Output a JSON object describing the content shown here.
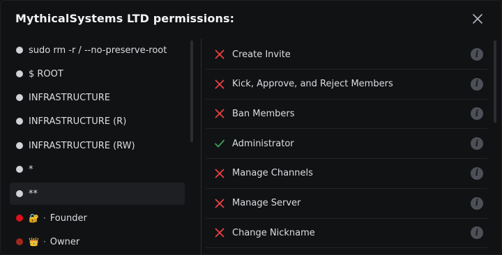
{
  "modal": {
    "title": "MythicalSystems LTD permissions:"
  },
  "roles": [
    {
      "name": "sudo rm -r / --no-preserve-root",
      "color": "#cfd3d8",
      "badge": "",
      "selected": false
    },
    {
      "name": "$ ROOT",
      "color": "#cfd3d8",
      "badge": "",
      "selected": false
    },
    {
      "name": "INFRASTRUCTURE",
      "color": "#cfd3d8",
      "badge": "",
      "selected": false
    },
    {
      "name": "INFRASTRUCTURE (R)",
      "color": "#cfd3d8",
      "badge": "",
      "selected": false
    },
    {
      "name": "INFRASTRUCTURE (RW)",
      "color": "#cfd3d8",
      "badge": "",
      "selected": false
    },
    {
      "name": "*",
      "color": "#cfd3d8",
      "badge": "",
      "selected": false
    },
    {
      "name": "**",
      "color": "#cfd3d8",
      "badge": "",
      "selected": true
    },
    {
      "name": "Founder",
      "color": "#e0101a",
      "badge": "🔐",
      "selected": false
    },
    {
      "name": "Owner",
      "color": "#a1281d",
      "badge": "👑",
      "selected": false
    }
  ],
  "permissions": [
    {
      "label": "Create Invite",
      "state": "denied"
    },
    {
      "label": "Kick, Approve, and Reject Members",
      "state": "denied"
    },
    {
      "label": "Ban Members",
      "state": "denied"
    },
    {
      "label": "Administrator",
      "state": "allowed"
    },
    {
      "label": "Manage Channels",
      "state": "denied"
    },
    {
      "label": "Manage Server",
      "state": "denied"
    },
    {
      "label": "Change Nickname",
      "state": "denied"
    }
  ],
  "colors": {
    "denied": "#ed4245",
    "allowed": "#3ba55d",
    "background": "#111214"
  },
  "icons": {
    "close": "close-icon",
    "info": "info-icon",
    "denied": "x-icon",
    "allowed": "check-icon"
  },
  "info_glyph": "i",
  "separator_glyph": "·"
}
